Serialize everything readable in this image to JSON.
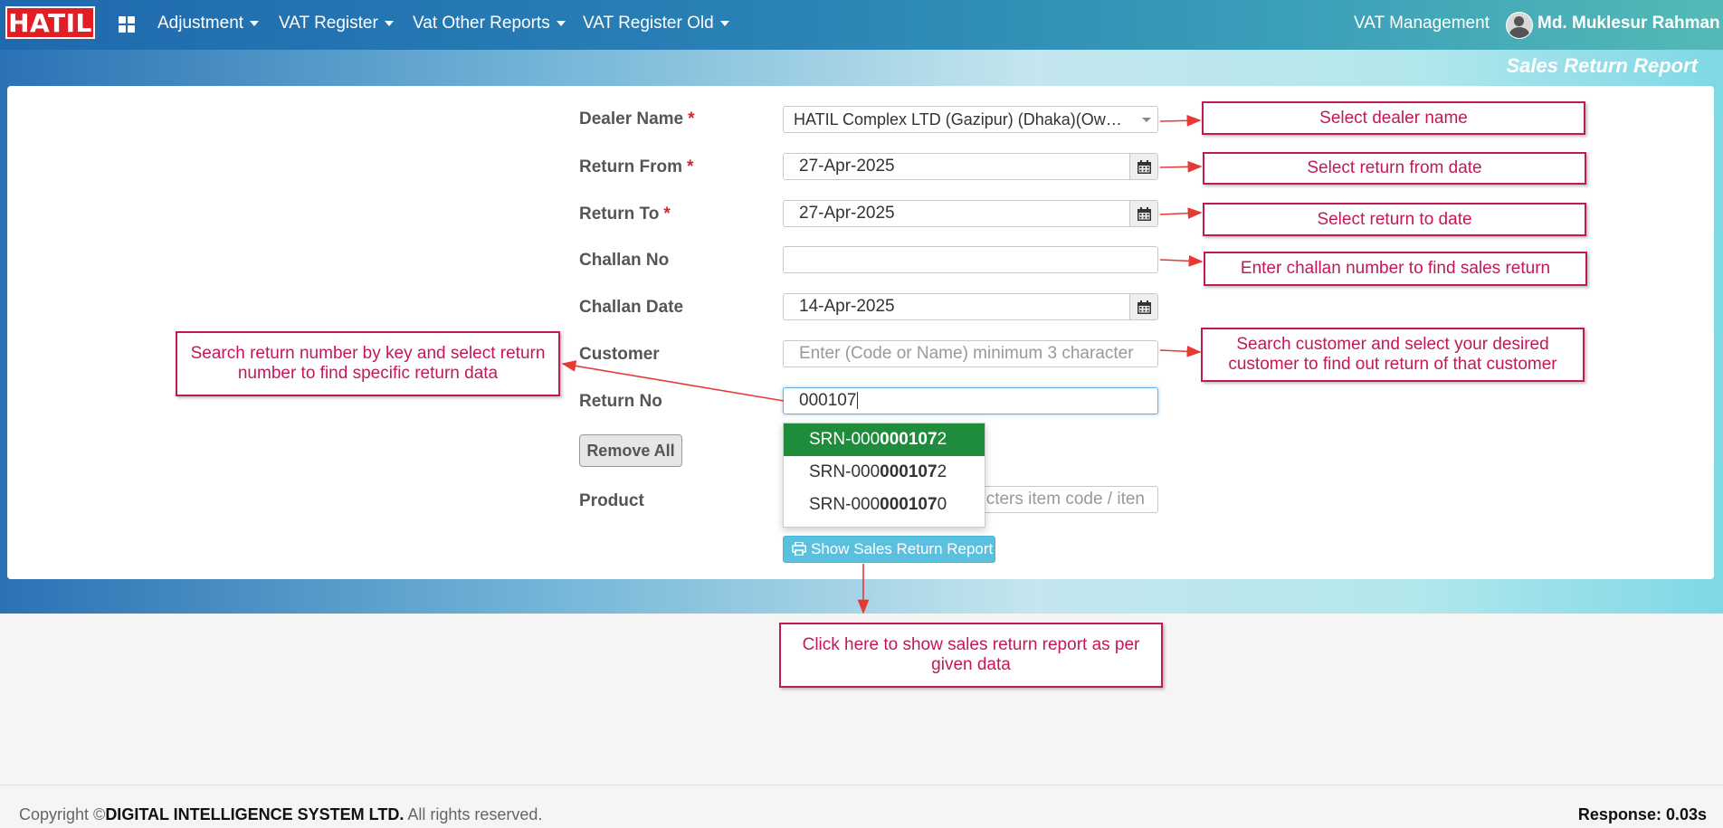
{
  "navbar": {
    "logo": "HATIL",
    "menus": [
      {
        "label": "Adjustment"
      },
      {
        "label": "VAT Register"
      },
      {
        "label": "Vat Other Reports"
      },
      {
        "label": "VAT Register Old"
      }
    ],
    "module": "VAT Management",
    "user": "Md. Muklesur Rahman"
  },
  "page_title": "Sales Return Report",
  "form": {
    "dealer_name": {
      "label": "Dealer Name",
      "value": "HATIL Complex LTD (Gazipur) (Dhaka)(Own Showroom)"
    },
    "return_from": {
      "label": "Return From",
      "value": "27-Apr-2025"
    },
    "return_to": {
      "label": "Return To",
      "value": "27-Apr-2025"
    },
    "challan_no": {
      "label": "Challan No",
      "value": ""
    },
    "challan_date": {
      "label": "Challan Date",
      "value": "14-Apr-2025"
    },
    "customer": {
      "label": "Customer",
      "placeholder": "Enter (Code or Name) minimum 3 character"
    },
    "return_no": {
      "label": "Return No",
      "value": "000107"
    },
    "product": {
      "label": "Product",
      "placeholder_visible": "cters item code / iten"
    },
    "required_mark": "*"
  },
  "autocomplete": [
    {
      "prefix": "SRN-000",
      "match": "000107",
      "suffix": "2",
      "active": true
    },
    {
      "prefix": "SRN-000",
      "match": "000107",
      "suffix": "2",
      "active": false
    },
    {
      "prefix": "SRN-000",
      "match": "000107",
      "suffix": "0",
      "active": false
    }
  ],
  "buttons": {
    "remove_all": "Remove All",
    "show_report": "Show Sales Return Report"
  },
  "annotations": {
    "dealer": "Select dealer name",
    "return_from": "Select return from date",
    "return_to": "Select return to date",
    "challan": "Enter challan number to find sales return",
    "customer": "Search customer and select your desired customer to find out return of that customer",
    "return_no": "Search return number by key and select return number to find specific return data",
    "show": "Click here to show sales return report as per given data"
  },
  "footer": {
    "copyright_prefix": "Copyright ©",
    "company": "DIGITAL INTELLIGENCE SYSTEM LTD.",
    "rights": " All rights reserved.",
    "response": "Response: 0.03s"
  },
  "colors": {
    "logo_red": "#e11d25",
    "annotation": "#c2185b",
    "active_item": "#1e8c3a",
    "show_button": "#5bc0de"
  }
}
